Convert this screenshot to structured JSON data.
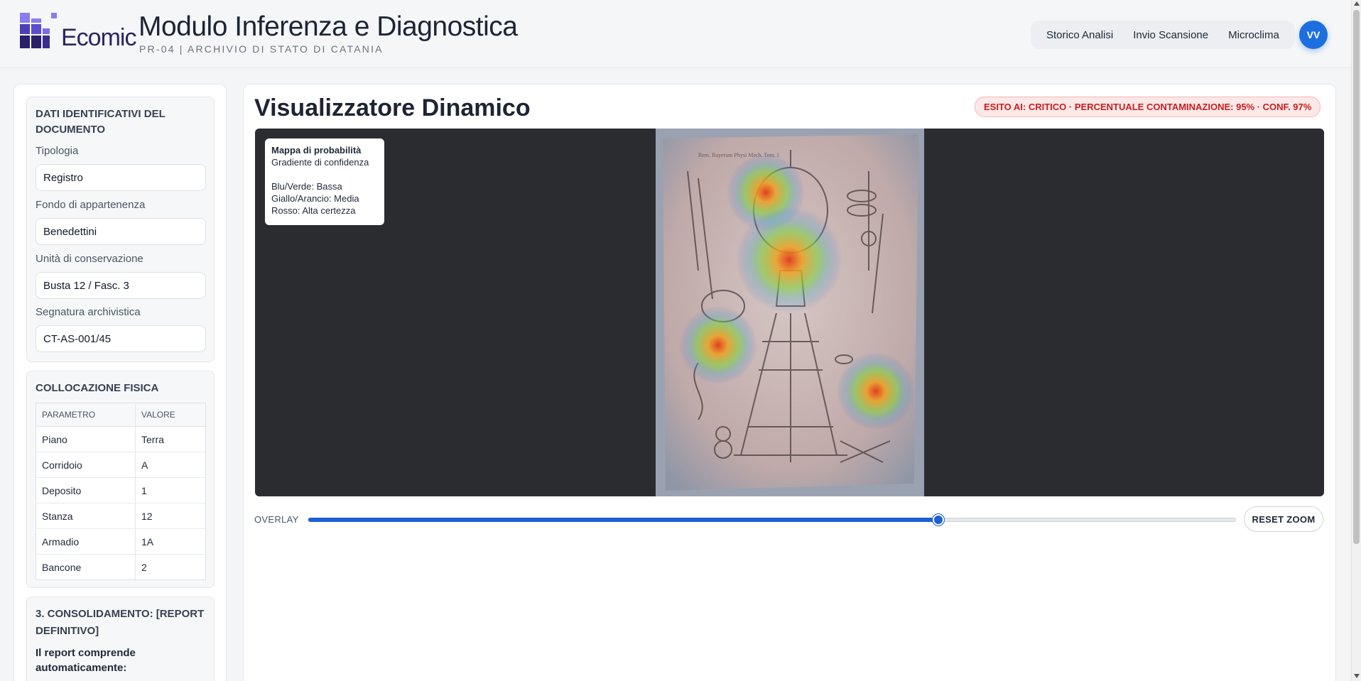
{
  "header": {
    "logo_text": "Ecomic",
    "title": "Modulo Inferenza e Diagnostica",
    "subtitle": "PR-04 | ARCHIVIO DI STATO DI CATANIA",
    "nav": [
      "Storico Analisi",
      "Invio Scansione",
      "Microclima"
    ],
    "avatar_initials": "VV"
  },
  "sidebar": {
    "identification": {
      "title": "DATI IDENTIFICATIVI DEL DOCUMENTO",
      "fields": [
        {
          "label": "Tipologia",
          "value": "Registro"
        },
        {
          "label": "Fondo di appartenenza",
          "value": "Benedettini"
        },
        {
          "label": "Unità di conservazione",
          "value": "Busta 12 / Fasc. 3"
        },
        {
          "label": "Segnatura archivistica",
          "value": "CT-AS-001/45"
        }
      ]
    },
    "location": {
      "title": "COLLOCAZIONE FISICA",
      "headers": [
        "PARAMETRO",
        "VALORE"
      ],
      "rows": [
        [
          "Piano",
          "Terra"
        ],
        [
          "Corridoio",
          "A"
        ],
        [
          "Deposito",
          "1"
        ],
        [
          "Stanza",
          "12"
        ],
        [
          "Armadio",
          "1A"
        ],
        [
          "Bancone",
          "2"
        ]
      ]
    },
    "consolidation": {
      "title": "3. CONSOLIDAMENTO: [REPORT DEFINITIVO]",
      "text": "Il report comprende automaticamente:"
    }
  },
  "main": {
    "title": "Visualizzatore Dinamico",
    "badge": "ESITO AI: CRITICO · PERCENTUALE CONTAMINAZIONE: 95% · CONF. 97%",
    "legend": {
      "title": "Mappa di probabilità",
      "subtitle": "Gradiente di confidenza",
      "low": "Blu/Verde: Bassa",
      "mid": "Giallo/Arancio: Media",
      "high": "Rosso: Alta certezza"
    },
    "overlay_label": "OVERLAY",
    "overlay_value": 0.68,
    "reset_label": "RESET ZOOM"
  },
  "colors": {
    "accent": "#1d5fd6",
    "critical": "#c81e1e",
    "viewer_bg": "#2a2c30"
  }
}
